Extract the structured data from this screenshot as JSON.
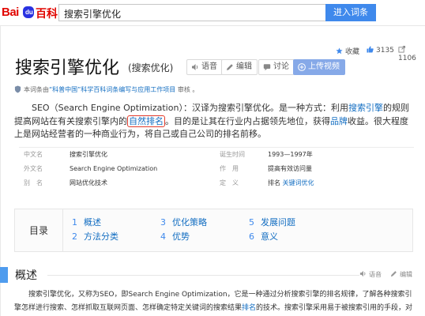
{
  "header": {
    "logo_bai": "Bai",
    "logo_du": "du",
    "logo_baike": "百科",
    "search_value": "搜索引擎优化",
    "search_button": "进入词条"
  },
  "entry": {
    "title": "搜索引擎优化",
    "subtitle": "(搜索优化)",
    "actions": {
      "voice": "语音",
      "edit": "编辑",
      "discuss": "讨论",
      "upload_video": "上传视频"
    },
    "stats": {
      "favorite": "收藏",
      "likes": "3135",
      "shares": "1106"
    },
    "source_note": {
      "prefix": "本词条由",
      "link": "“科普中国”科学百科词条编写与应用工作项目",
      "suffix": " 审核 。"
    }
  },
  "intro": {
    "p1_a": "SEO（Search Engine Optimization）：汉译为搜索引擎优化。是一种方式：利用",
    "p1_link1": "搜索引擎",
    "p1_b": "的规则提高网站在有关搜索引擎内的",
    "p1_highlight": "自然排名",
    "p1_c": "。目的是让其在行业内占据领先地位，获得",
    "p1_link2": "品牌",
    "p1_d": "收益。很大程度上是网站经营者的一种商业行为，将自己或自己公司的排名前移。"
  },
  "basic_info": [
    {
      "k1": "中文名",
      "v1": "搜索引擎优化",
      "k2": "诞生时间",
      "v2": "1993—1997年"
    },
    {
      "k1": "外文名",
      "v1": "Search Engine Optimization",
      "k2": "作　用",
      "v2": "提高有效访问量"
    },
    {
      "k1": "别　名",
      "v1": "网站优化技术",
      "k2": "定　义",
      "v2_pre": "排名 ",
      "v2": "关键词优化"
    }
  ],
  "catalog": {
    "title": "目录",
    "items": [
      {
        "num": "1",
        "label": "概述"
      },
      {
        "num": "2",
        "label": "方法分类"
      },
      {
        "num": "3",
        "label": "优化策略"
      },
      {
        "num": "4",
        "label": "优势"
      },
      {
        "num": "5",
        "label": "发展问题"
      },
      {
        "num": "6",
        "label": "意义"
      }
    ]
  },
  "section": {
    "title": "概述",
    "tool_voice": "语音",
    "tool_edit": "编辑",
    "line1": "搜索引擎优化，又称为SEO，即Search Engine Optimization，它是一种通过分析搜索引擎的排名规律，了解各种搜索引擎",
    "line2_a": "怎样进行搜索、怎样抓取互联网页面、怎样确定特定关键词的搜索结果",
    "line2_link": "排名",
    "line2_b": "的技术。搜索引擎采用易于被搜索引用的手段，对网"
  },
  "colors": {
    "brand_red": "#e10601",
    "brand_blue": "#2932e1",
    "link": "#136ec2",
    "button": "#3f89ec",
    "highlight_box": "#e23b2c"
  }
}
